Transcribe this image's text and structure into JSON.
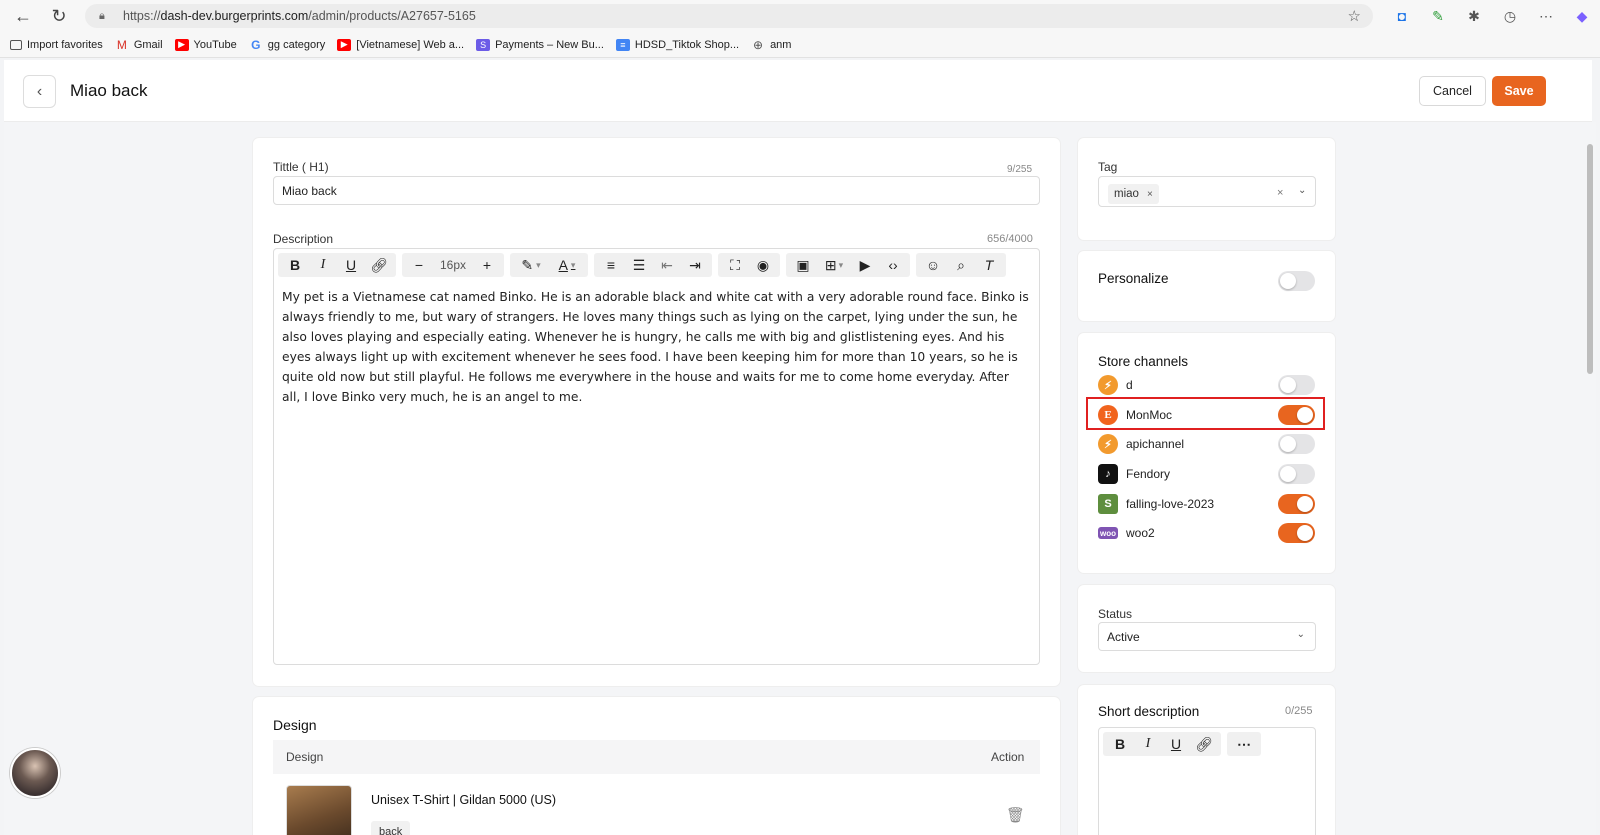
{
  "browser": {
    "url_prefix": "https://",
    "url_host": "dash-dev.burgerprints.com",
    "url_path": "/admin/products/A27657-5165",
    "bookmarks": [
      {
        "label": "Import favorites",
        "color": "#555555"
      },
      {
        "label": "Gmail",
        "color": "#d93025"
      },
      {
        "label": "YouTube",
        "color": "#ff0000"
      },
      {
        "label": "gg category",
        "color": "#4285f4"
      },
      {
        "label": "[Vietnamese] Web a...",
        "color": "#ff0000"
      },
      {
        "label": "Payments – New Bu...",
        "color": "#6c5ce7"
      },
      {
        "label": "HDSD_Tiktok Shop...",
        "color": "#4285f4"
      },
      {
        "label": "anm",
        "color": "#555555"
      }
    ]
  },
  "header": {
    "title": "Miao back",
    "cancel_label": "Cancel",
    "save_label": "Save"
  },
  "main": {
    "title_label": "Tittle ( H1)",
    "title_counter": "9/255",
    "title_value": "Miao back",
    "description_label": "Description",
    "description_counter": "656/4000",
    "font_size": "16px",
    "description_text": "My pet is a Vietnamese cat named Binko. He is an adorable black and white cat with a very adorable round face. Binko is always friendly to me, but wary of strangers. He loves many things such as lying on the carpet, lying under the sun, he also loves playing and especially eating. Whenever he is hungry, he calls me with big and glistlistening eyes. And his eyes always light up with excitement whenever he sees food. I have been keeping him for more than 10 years, so he is quite old now but still playful. He follows me everywhere in the house and waits for me to come home everyday. After all, I love Binko very much, he is an angel to me.",
    "design_section_title": "Design",
    "design_col_design": "Design",
    "design_col_action": "Action",
    "design_product_name": "Unisex T-Shirt | Gildan 5000 (US)",
    "design_variant": "back"
  },
  "sidebar": {
    "tag_label": "Tag",
    "tag_value": "miao",
    "personalize_label": "Personalize",
    "personalize_on": false,
    "store_channels_title": "Store channels",
    "channels": [
      {
        "name": "d",
        "icon": "bolt-icon",
        "on": false
      },
      {
        "name": "MonMoc",
        "icon": "etsy-icon",
        "on": true
      },
      {
        "name": "apichannel",
        "icon": "bolt-icon",
        "on": false
      },
      {
        "name": "Fendory",
        "icon": "tiktok-icon",
        "on": false
      },
      {
        "name": "falling-love-2023",
        "icon": "shopify-icon",
        "on": true
      },
      {
        "name": "woo2",
        "icon": "woocommerce-icon",
        "on": true
      }
    ],
    "status_label": "Status",
    "status_value": "Active",
    "short_description_title": "Short description",
    "short_description_counter": "0/255"
  },
  "colors": {
    "accent": "#e8651f",
    "highlight": "#e02020"
  }
}
